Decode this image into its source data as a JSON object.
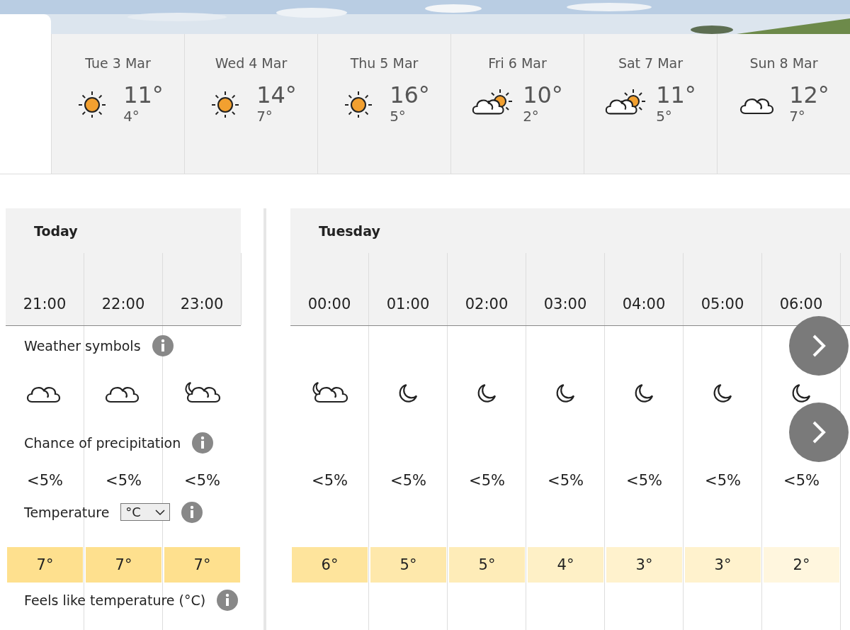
{
  "days": [
    {
      "date": "Tue 3 Mar",
      "kind": "sun",
      "high": "11°",
      "low": "4°"
    },
    {
      "date": "Wed 4 Mar",
      "kind": "sun",
      "high": "14°",
      "low": "7°"
    },
    {
      "date": "Thu 5 Mar",
      "kind": "sun",
      "high": "16°",
      "low": "5°"
    },
    {
      "date": "Fri 6 Mar",
      "kind": "sun-cloud",
      "high": "10°",
      "low": "2°"
    },
    {
      "date": "Sat 7 Mar",
      "kind": "sun-cloud",
      "high": "11°",
      "low": "5°"
    },
    {
      "date": "Sun 8 Mar",
      "kind": "cloud",
      "high": "12°",
      "low": "7°"
    }
  ],
  "labels": {
    "symbols": "Weather symbols",
    "precip": "Chance of precipitation",
    "temperature": "Temperature",
    "unit": "°C",
    "feels": "Feels like temperature (°C)"
  },
  "sections": [
    {
      "title": "Today",
      "hours": [
        {
          "time": "21:00",
          "kind": "cloud",
          "precip": "<5%",
          "temp": "7°",
          "color": "#fee08e"
        },
        {
          "time": "22:00",
          "kind": "cloud",
          "precip": "<5%",
          "temp": "7°",
          "color": "#fee08e"
        },
        {
          "time": "23:00",
          "kind": "moon-cloud",
          "precip": "<5%",
          "temp": "7°",
          "color": "#fee08e"
        }
      ]
    },
    {
      "title": "Tuesday",
      "hours": [
        {
          "time": "00:00",
          "kind": "moon-cloud",
          "precip": "<5%",
          "temp": "6°",
          "color": "#fee49c"
        },
        {
          "time": "01:00",
          "kind": "moon",
          "precip": "<5%",
          "temp": "5°",
          "color": "#fee8ab"
        },
        {
          "time": "02:00",
          "kind": "moon",
          "precip": "<5%",
          "temp": "5°",
          "color": "#feecb8"
        },
        {
          "time": "03:00",
          "kind": "moon",
          "precip": "<5%",
          "temp": "4°",
          "color": "#fef0c6"
        },
        {
          "time": "04:00",
          "kind": "moon",
          "precip": "<5%",
          "temp": "3°",
          "color": "#fff2cd"
        },
        {
          "time": "05:00",
          "kind": "moon",
          "precip": "<5%",
          "temp": "3°",
          "color": "#fff2cd"
        },
        {
          "time": "06:00",
          "kind": "moon",
          "precip": "<5%",
          "temp": "2°",
          "color": "#fff6de"
        }
      ]
    }
  ]
}
